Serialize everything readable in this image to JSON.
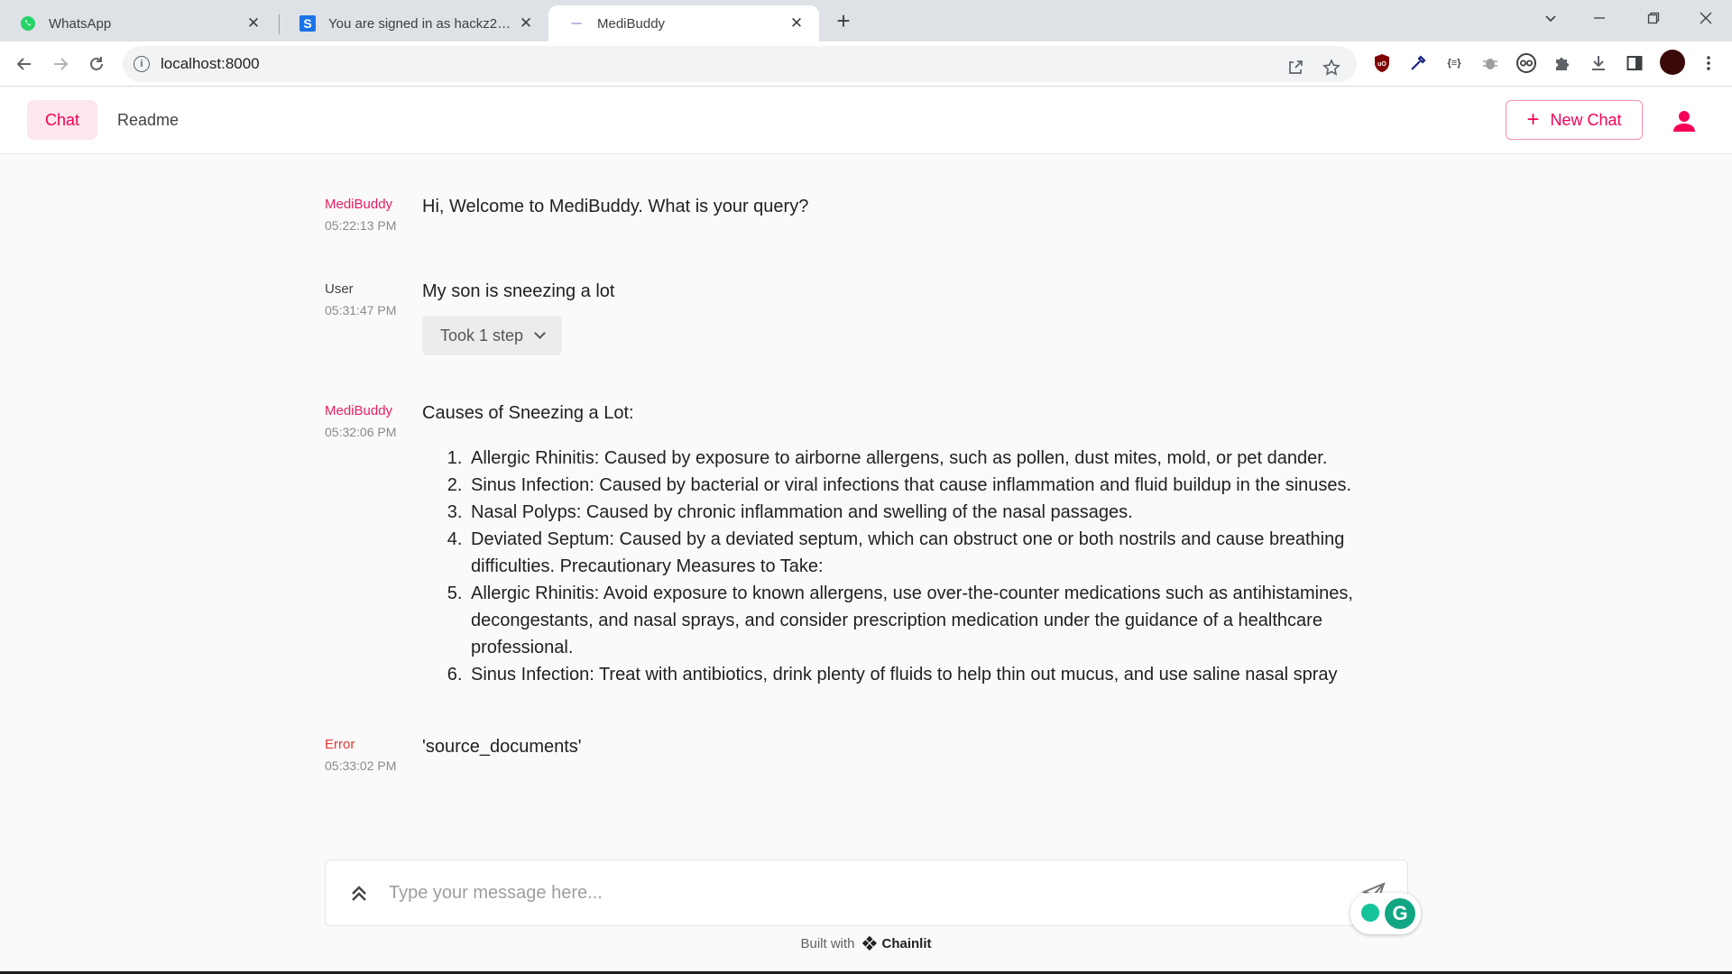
{
  "browser": {
    "tabs": [
      {
        "title": "WhatsApp",
        "icon": "whatsapp-icon",
        "active": false
      },
      {
        "title": "You are signed in as hackz2023",
        "icon": "s-logo-icon",
        "active": false
      },
      {
        "title": "MediBuddy",
        "icon": "medibuddy-favicon",
        "active": true
      }
    ],
    "new_tab_label": "+",
    "url": "localhost:8000"
  },
  "header": {
    "tabs": [
      {
        "label": "Chat",
        "active": true
      },
      {
        "label": "Readme",
        "active": false
      }
    ],
    "new_chat_label": "New Chat",
    "accent_color": "#f50057"
  },
  "messages": [
    {
      "author": "MediBuddy",
      "time": "05:22:13 PM",
      "text": "Hi, Welcome to MediBuddy. What is your query?"
    },
    {
      "author": "User",
      "time": "05:31:47 PM",
      "text": "My son is sneezing a lot",
      "step_label": "Took 1 step"
    },
    {
      "author": "MediBuddy",
      "time": "05:32:06 PM",
      "heading": "Causes of Sneezing a Lot:",
      "items": [
        "Allergic Rhinitis: Caused by exposure to airborne allergens, such as pollen, dust mites, mold, or pet dander.",
        "Sinus Infection: Caused by bacterial or viral infections that cause inflammation and fluid buildup in the sinuses.",
        "Nasal Polyps: Caused by chronic inflammation and swelling of the nasal passages.",
        "Deviated Septum: Caused by a deviated septum, which can obstruct one or both nostrils and cause breathing difficulties. Precautionary Measures to Take:",
        "Allergic Rhinitis: Avoid exposure to known allergens, use over-the-counter medications such as antihistamines, decongestants, and nasal sprays, and consider prescription medication under the guidance of a healthcare professional.",
        "Sinus Infection: Treat with antibiotics, drink plenty of fluids to help thin out mucus, and use saline nasal spray"
      ]
    },
    {
      "author": "Error",
      "time": "05:33:02 PM",
      "text": "'source_documents'"
    }
  ],
  "composer": {
    "placeholder": "Type your message here..."
  },
  "footer": {
    "built_with": "Built with",
    "brand": "Chainlit"
  }
}
